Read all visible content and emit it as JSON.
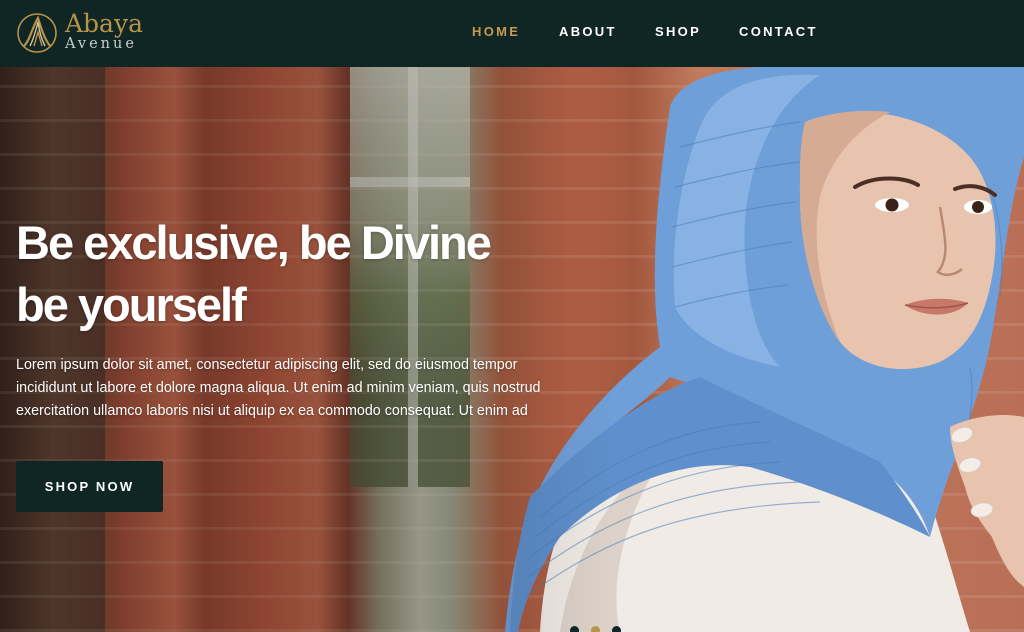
{
  "brand": {
    "name_line1": "Abaya",
    "name_line2": "Avenue",
    "color_gold": "#b8934a",
    "logo_icon": "abaya-logo-icon"
  },
  "nav": {
    "items": [
      {
        "label": "HOME",
        "active": true
      },
      {
        "label": "ABOUT",
        "active": false
      },
      {
        "label": "SHOP",
        "active": false
      },
      {
        "label": "CONTACT",
        "active": false
      }
    ],
    "active_color": "#c79a52"
  },
  "hero": {
    "headline_line1": "Be exclusive, be Divine",
    "headline_line2": "be yourself",
    "lead_line1": "Lorem ipsum dolor sit amet, consectetur adipiscing elit, sed do eiusmod tempor",
    "lead_line2": "incididunt ut labore et dolore magna aliqua. Ut enim ad minim veniam, quis nostrud",
    "lead_line3": "exercitation ullamco laboris nisi ut aliquip ex ea commodo consequat. Ut enim ad",
    "cta_label": "SHOP NOW",
    "image_icon": "hero-model-image",
    "slider": {
      "count": 3,
      "active_index": 1
    }
  },
  "colors": {
    "header_bg": "#0f2624",
    "button_bg": "#0f2624",
    "scarf_blue": "#6f9fd8"
  }
}
